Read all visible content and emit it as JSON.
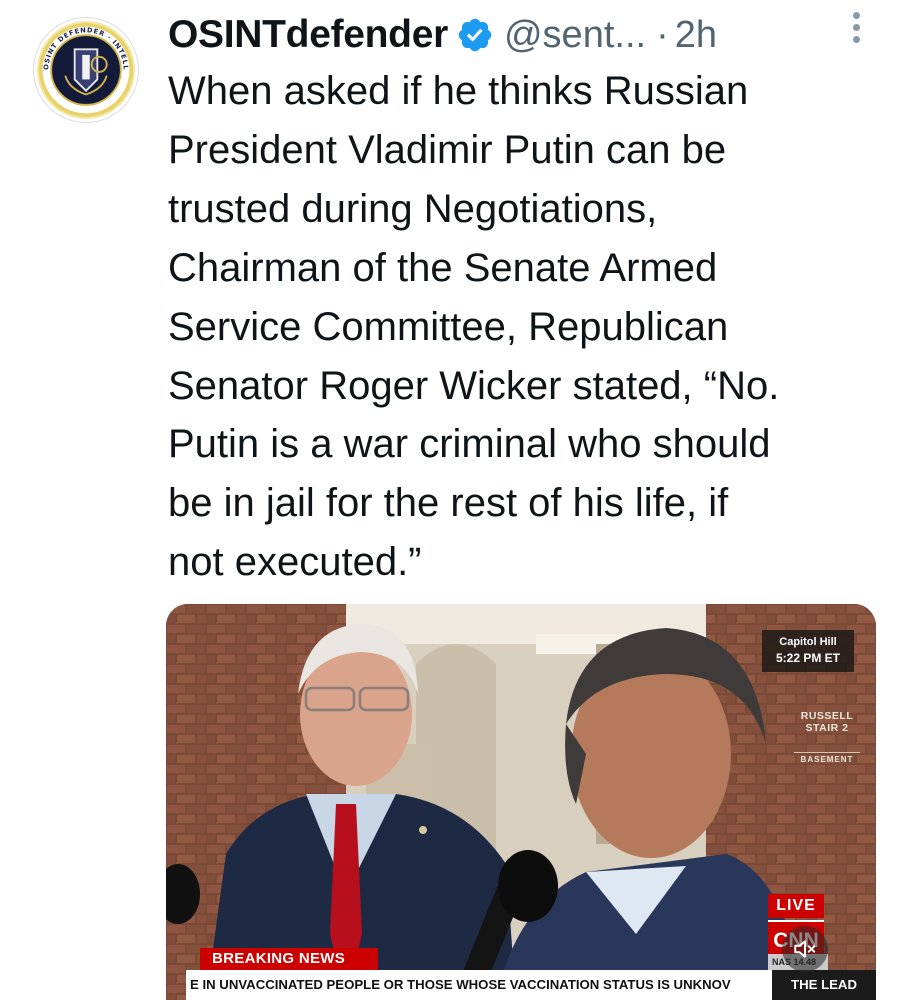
{
  "post": {
    "author": {
      "display_name": "OSINTdefender",
      "handle": "@sent...",
      "verified_icon": "verified-badge-icon",
      "avatar_icon": "osint-defender-seal-icon",
      "avatar_ring_text": "OSINT DEFENDER · INTELLIGENCE MONITOR"
    },
    "separator": "·",
    "time": "2h",
    "more_icon": "more-vertical-icon",
    "text_lines": [
      "When asked if he thinks Russian",
      "President Vladimir Putin can be",
      "trusted during Negotiations,",
      "Chairman of the Senate Armed",
      "Service Committee, Republican",
      "Senator Roger Wicker stated, “No.",
      "Putin is a war criminal who should",
      "be in jail for the rest of his life, if",
      "not executed.”"
    ]
  },
  "media": {
    "location_line1": "Capitol Hill",
    "location_line2": "5:22 PM ET",
    "sign_line1": "RUSSELL",
    "sign_line2": "STAIR 2",
    "sign_line3": "BASEMENT",
    "live_label": "LIVE",
    "network_logo": "CNN",
    "ticker_value": "NAS 14.48",
    "breaking_label": "BREAKING NEWS",
    "crawl_text": "E IN UNVACCINATED PEOPLE OR THOSE WHOSE VACCINATION STATUS IS UNKNOV",
    "crawl_show": "THE LEAD",
    "mute_icon": "volume-muted-icon"
  },
  "colors": {
    "text": "#0f1419",
    "secondary": "#536471",
    "verified": "#1d9bf0",
    "cnn_red": "#cc0000"
  }
}
